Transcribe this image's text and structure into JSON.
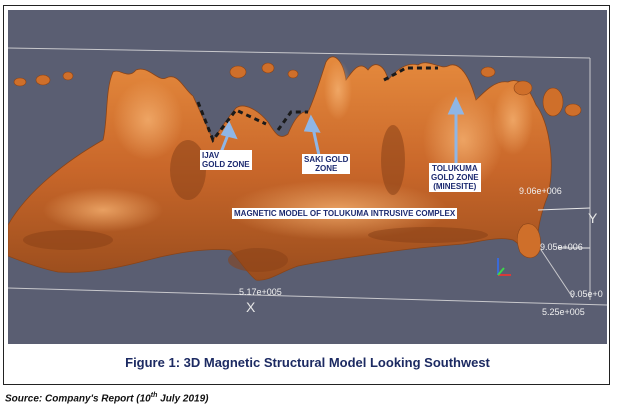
{
  "figure": {
    "caption": "Figure 1: 3D Magnetic Structural Model Looking Southwest",
    "labels": {
      "ijav_line1": "IJAV",
      "ijav_line2": "GOLD ZONE",
      "saki_line1": "SAKI GOLD",
      "saki_line2": "ZONE",
      "tolukuma_line1": "TOLUKUMA",
      "tolukuma_line2": "GOLD ZONE",
      "tolukuma_line3": "(MINESITE)",
      "model": "MAGNETIC MODEL OF TOLUKUMA INTRUSIVE COMPLEX"
    },
    "axes": {
      "x_letter": "X",
      "y_letter": "Y",
      "x_tick_1": "5.17e+005",
      "x_tick_2": "5.25e+005",
      "y_tick_1": "9.06e+006",
      "y_tick_2": "9.05e+006",
      "y_tick_3": "9.05e+0"
    },
    "colors": {
      "background": "#5a5e72",
      "body": "#cf6f2a",
      "label_text": "#1c2a70",
      "arrow": "#8fb6e6"
    }
  },
  "source": {
    "prefix": "Source: Company's Report (10",
    "sup": "th",
    "suffix": " July 2019)"
  }
}
